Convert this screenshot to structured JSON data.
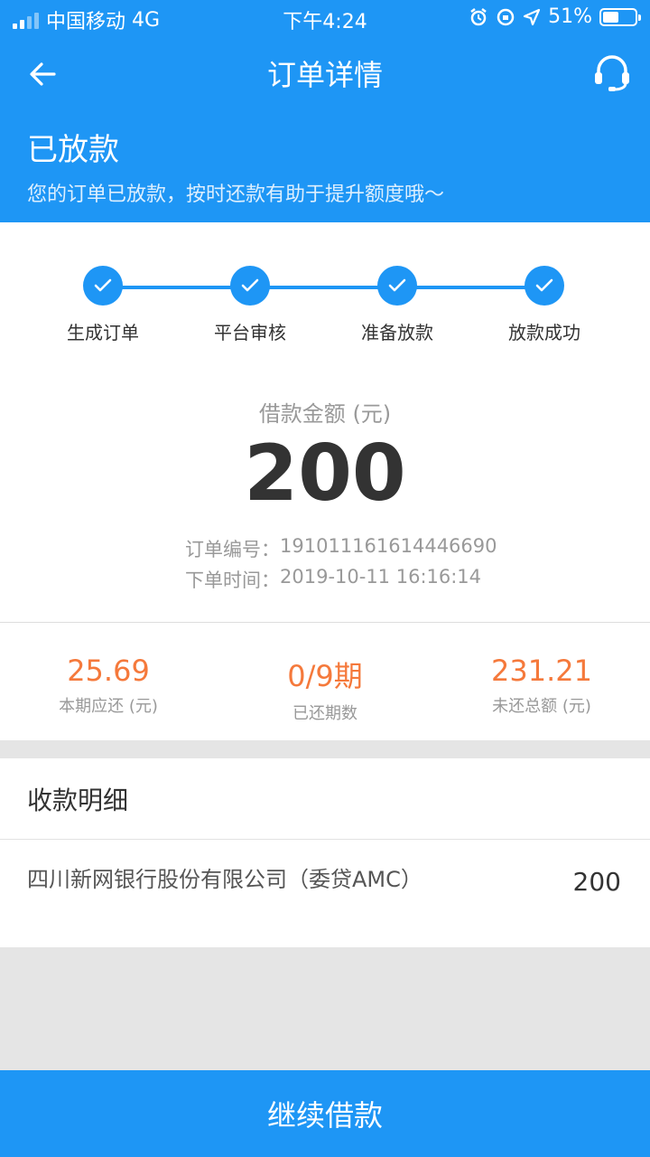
{
  "status_bar": {
    "carrier": "中国移动",
    "network": "4G",
    "time": "下午4:24",
    "battery_percent": "51%",
    "battery_level": 0.51
  },
  "nav": {
    "title": "订单详情",
    "back_icon": "arrow-left-icon",
    "service_icon": "headset-icon"
  },
  "status": {
    "title": "已放款",
    "description": "您的订单已放款，按时还款有助于提升额度哦～"
  },
  "steps": [
    {
      "label": "生成订单",
      "done": true
    },
    {
      "label": "平台审核",
      "done": true
    },
    {
      "label": "准备放款",
      "done": true
    },
    {
      "label": "放款成功",
      "done": true
    }
  ],
  "loan": {
    "amount_label": "借款金额 (元)",
    "amount": "200",
    "order_no_label": "订单编号：",
    "order_no": "191011161614446690",
    "order_time_label": "下单时间：",
    "order_time": "2019-10-11 16:16:14"
  },
  "stats": [
    {
      "value": "25.69",
      "label": "本期应还 (元)"
    },
    {
      "value": "0/9期",
      "label": "已还期数"
    },
    {
      "value": "231.21",
      "label": "未还总额 (元)"
    }
  ],
  "receipt": {
    "title": "收款明细",
    "rows": [
      {
        "name": "四川新网银行股份有限公司（委贷AMC）",
        "amount": "200"
      }
    ]
  },
  "bottom_button": "继续借款",
  "colors": {
    "primary": "#1e96f5",
    "accent": "#f5793b"
  }
}
